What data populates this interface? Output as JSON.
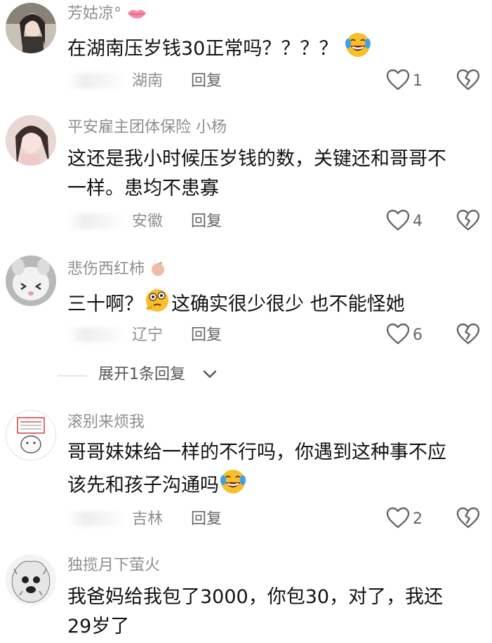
{
  "comments": [
    {
      "username": "芳姑凉°",
      "content_before": "在湖南压岁钱30正常吗？？？？",
      "content_after": "",
      "location": "湖南",
      "reply": "回复",
      "likes": "1"
    },
    {
      "username": "平安雇主团体保险  小杨",
      "content_line1": "这还是我小时候压岁钱的数，关键还和哥哥不",
      "content_line2": "一样。患均不患寡",
      "location": "安徽",
      "reply": "回复",
      "likes": "4"
    },
    {
      "username": "悲伤西红柿",
      "content_before": "三十啊？",
      "content_after": "这确实很少很少 也不能怪她",
      "location": "辽宁",
      "reply": "回复",
      "likes": "6"
    },
    {
      "username": "滚别来烦我",
      "content_line1": "哥哥妹妹给一样的不行吗，你遇到这种事不应",
      "content_line2": "该先和孩子沟通吗",
      "location": "吉林",
      "reply": "回复",
      "likes": "2"
    },
    {
      "username": "独揽月下萤火",
      "content_line1": "我爸妈给我包了3000，你包30，对了，我还",
      "content_line2": "29岁了"
    }
  ],
  "expand_replies": "展开1条回复",
  "icons": {
    "like": "heart-outline-icon",
    "dislike": "broken-heart-icon",
    "expand": "chevron-down-icon",
    "emoji_laugh_cry": "tears-of-joy-emoji",
    "emoji_thinking": "woozy-thinking-emoji",
    "username_badge": "lips-icon",
    "username_badge_2": "peach-icon"
  },
  "colors": {
    "username": "#8e8e93",
    "text": "#111111",
    "meta": "#666666"
  }
}
